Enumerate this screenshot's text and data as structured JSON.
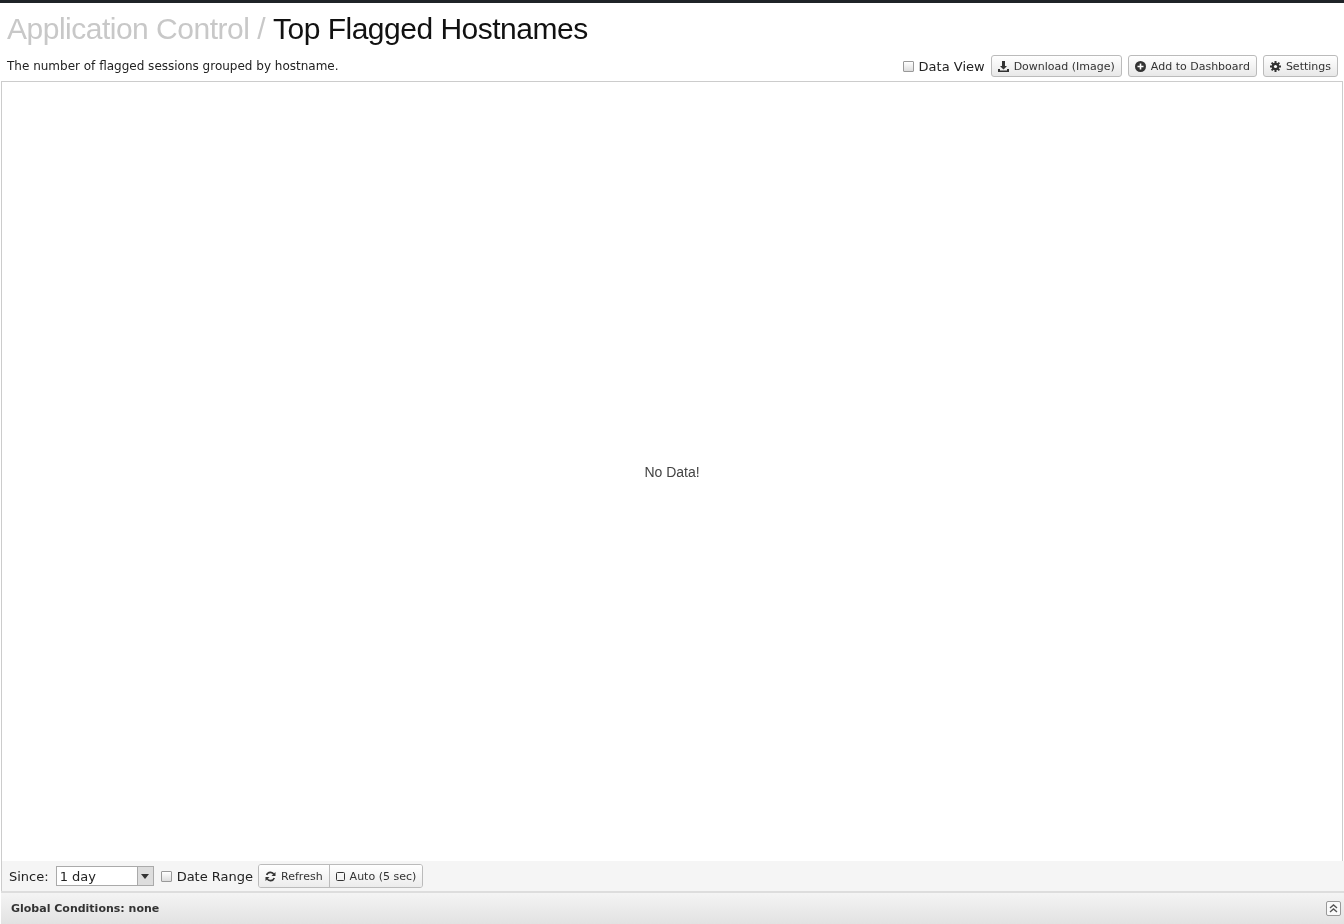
{
  "header": {
    "breadcrumb": "Application Control /",
    "title": "Top Flagged Hostnames",
    "description": "The number of flagged sessions grouped by hostname.",
    "data_view": {
      "label": "Data View",
      "checked": false
    },
    "buttons": [
      {
        "kind": "download",
        "label": "Download (Image)"
      },
      {
        "kind": "add",
        "label": "Add to Dashboard"
      },
      {
        "kind": "settings",
        "label": "Settings"
      }
    ]
  },
  "chart": {
    "message": "No Data!"
  },
  "toolbar": {
    "since_label": "Since:",
    "since_value": "1 day",
    "date_range": {
      "label": "Date Range",
      "checked": false
    },
    "refresh": "Refresh",
    "auto": {
      "label": "Auto (5 sec)",
      "checked": false
    }
  },
  "global_conditions": {
    "text": "Global Conditions: none",
    "expanded": false
  }
}
